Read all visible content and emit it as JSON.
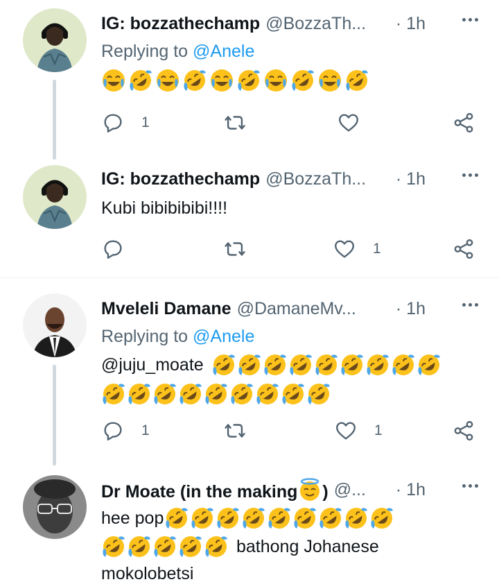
{
  "tweets": [
    {
      "name": "IG: bozzathechamp",
      "handle": "@BozzaTh...",
      "time": "· 1h",
      "replying_label": "Replying to ",
      "replying_to": "@Anele",
      "text": "",
      "emojis": [
        "joy",
        "rofl",
        "joy",
        "rofl",
        "joy",
        "rofl",
        "joy",
        "rofl",
        "joy",
        "rofl"
      ],
      "replies": "1",
      "retweets": "",
      "likes": ""
    },
    {
      "name": "IG: bozzathechamp",
      "handle": "@BozzaTh...",
      "time": "· 1h",
      "text": "Kubi bibibibibi!!!!",
      "replies": "",
      "retweets": "",
      "likes": "1"
    },
    {
      "name": "Mveleli Damane",
      "handle": "@DamaneMv...",
      "time": "· 1h",
      "replying_label": "Replying to ",
      "replying_to": "@Anele",
      "mention": "@juju_moate",
      "emoji_line1_count": 9,
      "emoji_line2_count": 9,
      "replies": "1",
      "retweets": "",
      "likes": "1"
    },
    {
      "name": "Dr Moate (in the making",
      "name_end": ")",
      "handle": "@...",
      "time": "· 1h",
      "text_start": "hee pop",
      "text_mid": "bathong Johanese",
      "text_end": "mokolobetsi",
      "emoji_line1_count": 9,
      "emoji_line2_count": 5
    }
  ],
  "icons": {
    "reply": "reply-icon",
    "retweet": "retweet-icon",
    "like": "heart-icon",
    "share": "share-icon",
    "more": "more-icon"
  },
  "colors": {
    "link": "#1d9bf0",
    "secondary_text": "#536471",
    "thread_line": "#cfd9de",
    "emoji_face": "#fcc21b"
  }
}
